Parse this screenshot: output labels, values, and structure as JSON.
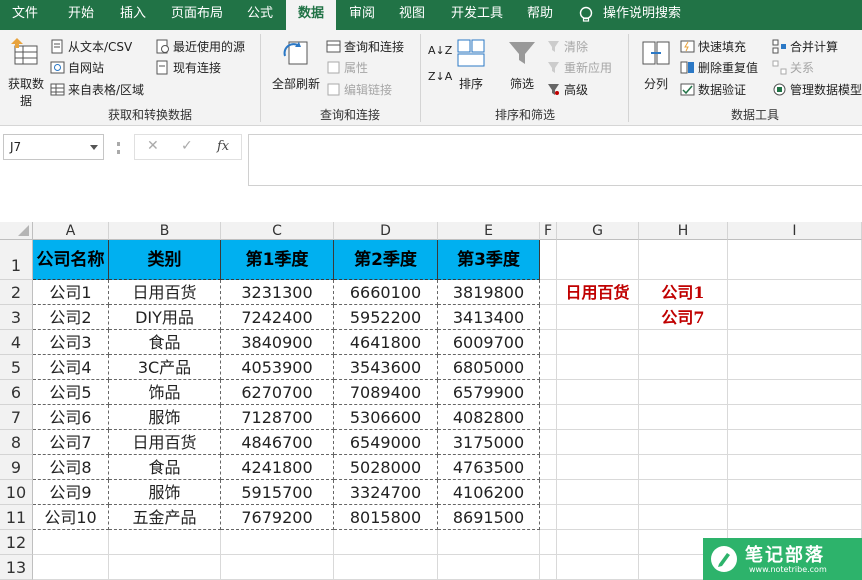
{
  "tabs": [
    {
      "label": "文件",
      "active": false
    },
    {
      "label": "开始",
      "active": false
    },
    {
      "label": "插入",
      "active": false
    },
    {
      "label": "页面布局",
      "active": false
    },
    {
      "label": "公式",
      "active": false
    },
    {
      "label": "数据",
      "active": true
    },
    {
      "label": "审阅",
      "active": false
    },
    {
      "label": "视图",
      "active": false
    },
    {
      "label": "开发工具",
      "active": false
    },
    {
      "label": "帮助",
      "active": false
    }
  ],
  "tell_me": {
    "label": "操作说明搜索",
    "icon": "lightbulb-icon"
  },
  "ribbon": {
    "get_data": {
      "big_label_1": "获取数",
      "big_label_2": "据",
      "from_text_csv": "从文本/CSV",
      "from_web": "自网站",
      "from_table": "来自表格/区域",
      "recent_sources": "最近使用的源",
      "existing_connections": "现有连接",
      "group_label": "获取和转换数据"
    },
    "queries": {
      "refresh_all": "全部刷新",
      "queries_connections": "查询和连接",
      "properties": "属性",
      "edit_links": "编辑链接",
      "group_label": "查询和连接"
    },
    "sort_filter": {
      "sort": "排序",
      "filter": "筛选",
      "clear": "清除",
      "reapply": "重新应用",
      "advanced": "高级",
      "group_label": "排序和筛选"
    },
    "data_tools": {
      "split": "分列",
      "flash_fill": "快速填充",
      "remove_duplicates": "删除重复值",
      "data_validation": "数据验证",
      "consolidate": "合并计算",
      "relationships": "关系",
      "data_model": "管理数据模型",
      "group_label": "数据工具"
    }
  },
  "formula_bar": {
    "name_box": "J7",
    "cancel": "✕",
    "enter": "✓",
    "fx": "fx",
    "value": ""
  },
  "columns": [
    "A",
    "B",
    "C",
    "D",
    "E",
    "F",
    "G",
    "H",
    "I"
  ],
  "rows": [
    "1",
    "2",
    "3",
    "4",
    "5",
    "6",
    "7",
    "8",
    "9",
    "10",
    "11",
    "12",
    "13"
  ],
  "table": {
    "headers": [
      "公司名称",
      "类别",
      "第1季度",
      "第2季度",
      "第3季度"
    ],
    "rows": [
      [
        "公司1",
        "日用百货",
        "3231300",
        "6660100",
        "3819800"
      ],
      [
        "公司2",
        "DIY用品",
        "7242400",
        "5952200",
        "3413400"
      ],
      [
        "公司3",
        "食品",
        "3840900",
        "4641800",
        "6009700"
      ],
      [
        "公司4",
        "3C产品",
        "4053900",
        "3543600",
        "6805000"
      ],
      [
        "公司5",
        "饰品",
        "6270700",
        "7089400",
        "6579900"
      ],
      [
        "公司6",
        "服饰",
        "7128700",
        "5306600",
        "4082800"
      ],
      [
        "公司7",
        "日用百货",
        "4846700",
        "6549000",
        "3175000"
      ],
      [
        "公司8",
        "食品",
        "4241800",
        "5028000",
        "4763500"
      ],
      [
        "公司9",
        "服饰",
        "5915700",
        "3324700",
        "4106200"
      ],
      [
        "公司10",
        "五金产品",
        "7679200",
        "8015800",
        "8691500"
      ]
    ]
  },
  "lookup": {
    "g2": "日用百货",
    "h2": "公司1",
    "h3": "公司7",
    "color": "#c00000"
  },
  "watermark": {
    "title": "笔记部落",
    "sub": "www.notetribe.com",
    "color": "#2db36b"
  },
  "colors": {
    "excel_green": "#217346",
    "header_fill": "#00b0f0"
  }
}
